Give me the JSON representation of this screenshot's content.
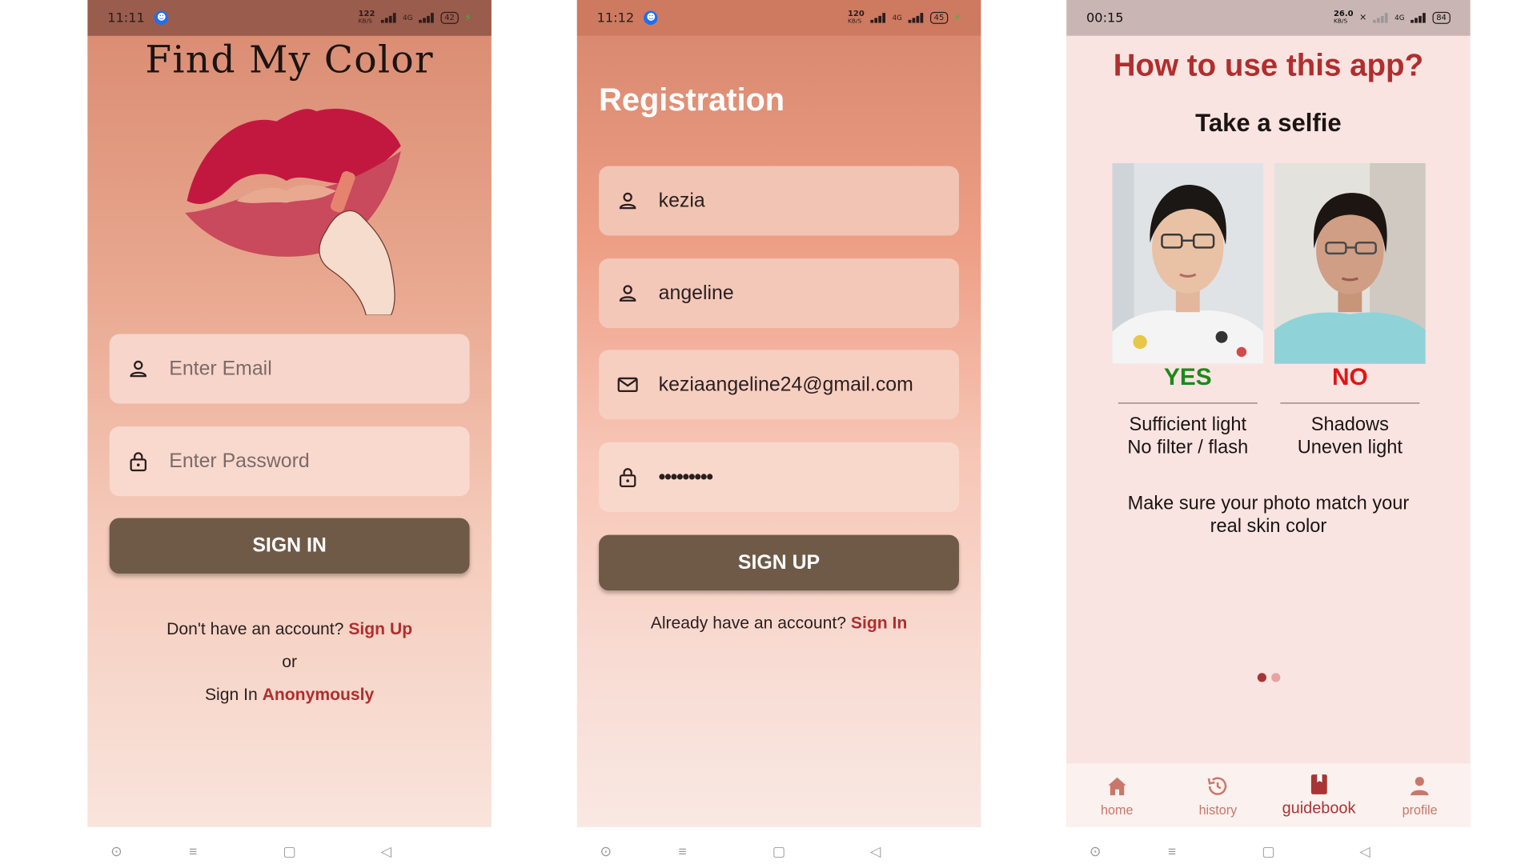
{
  "colors": {
    "button": "#6f5a48",
    "link": "#b02e2e",
    "yes": "#1a8a1a",
    "no": "#e01515",
    "nav_inactive": "#c9776b",
    "nav_active": "#a83535"
  },
  "screen1": {
    "status": {
      "time": "11:11",
      "speed_top": "122",
      "speed_bottom": "KB/S",
      "network": "4G",
      "battery": "42"
    },
    "app_title": "Find My Color",
    "email": {
      "placeholder": "Enter Email",
      "icon": "person-icon"
    },
    "password": {
      "placeholder": "Enter Password",
      "icon": "lock-icon"
    },
    "sign_in_button": "SIGN IN",
    "no_account_text": "Don't have an account?",
    "sign_up_link": "Sign Up",
    "or_text": "or",
    "sign_in_text": "Sign In",
    "anonymously_link": "Anonymously"
  },
  "screen2": {
    "status": {
      "time": "11:12",
      "speed_top": "120",
      "speed_bottom": "KB/S",
      "network": "4G",
      "battery": "45"
    },
    "title": "Registration",
    "first_name": {
      "value": "kezia",
      "icon": "person-icon"
    },
    "last_name": {
      "value": "angeline",
      "icon": "person-icon"
    },
    "email": {
      "value": "keziaangeline24@gmail.com",
      "icon": "mail-icon"
    },
    "password": {
      "value": "•••••••••",
      "icon": "lock-icon"
    },
    "sign_up_button": "SIGN UP",
    "have_account_text": "Already have an account?",
    "sign_in_link": "Sign In"
  },
  "screen3": {
    "status": {
      "time": "00:15",
      "speed_top": "26.0",
      "speed_bottom": "KB/S",
      "network": "4G",
      "battery": "84"
    },
    "heading": "How to use this app?",
    "subheading": "Take a selfie",
    "yes": {
      "label": "YES",
      "line1": "Sufficient light",
      "line2": "No filter / flash"
    },
    "no": {
      "label": "NO",
      "line1": "Shadows",
      "line2": "Uneven light"
    },
    "note_line1": "Make sure your photo match your",
    "note_line2": "real skin color",
    "pager": {
      "count": 2,
      "active": 1
    },
    "nav": [
      {
        "label": "home",
        "icon": "home-icon"
      },
      {
        "label": "history",
        "icon": "history-icon"
      },
      {
        "label": "guidebook",
        "icon": "book-icon",
        "active": true
      },
      {
        "label": "profile",
        "icon": "profile-icon"
      }
    ]
  }
}
